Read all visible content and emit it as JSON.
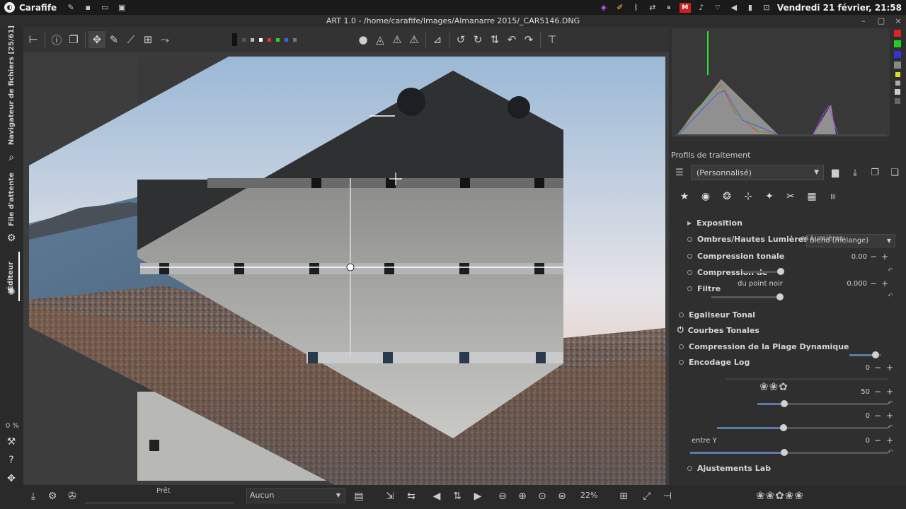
{
  "system": {
    "app_name": "Carafife",
    "clock": "Vendredi 21 février, 21:58",
    "left_icons": [
      "edit-icon",
      "terminal-icon",
      "window-icon",
      "screen-icon"
    ],
    "right_icons": [
      "color-icon",
      "pen-icon",
      "bluetooth-icon",
      "network-icon",
      "pause-icon",
      "mail-icon",
      "bell-icon",
      "wifi-icon",
      "volume-icon",
      "battery-icon",
      "lock-icon"
    ]
  },
  "window": {
    "title": "ART 1.0 - /home/carafife/Images/Almanarre 2015/_CAR5146.DNG",
    "minimize": "–",
    "maximize": "□",
    "close": "×"
  },
  "left_tabs": {
    "file_browser": "Navigateur de fichiers [25/61]",
    "queue": "File d'attente",
    "editor": "Éditeur",
    "percent": "0 %"
  },
  "profiles": {
    "title": "Profils de traitement",
    "selected": "(Personnalisé)"
  },
  "tools": {
    "exposure": "Exposition",
    "shadows": "Ombres/Hautes Lumières",
    "tone_compression": "Compression tonale",
    "compression_d": "Compression de",
    "filter": "Filtre",
    "tonal_equalizer": "Egaliseur Tonal",
    "tone_curves": "Courbes Tonales",
    "dynamic_range": "Compression de la Plage Dynamique",
    "log_encoding": "Encodage Log",
    "lab_adjustments": "Ajustements Lab"
  },
  "ghost": {
    "lights_label": "es Lumières:",
    "blend_value": "Blend (mélange)",
    "black_point_label": "du point noir",
    "value_1": "0.00",
    "value_2": "0.000",
    "value_3": "0",
    "value_4": "50",
    "value_5": "0",
    "centre_y_label": "entre Y",
    "value_6": "0"
  },
  "bottom": {
    "status": "Prêt",
    "exif_select": "Aucun",
    "zoom": "22%"
  }
}
